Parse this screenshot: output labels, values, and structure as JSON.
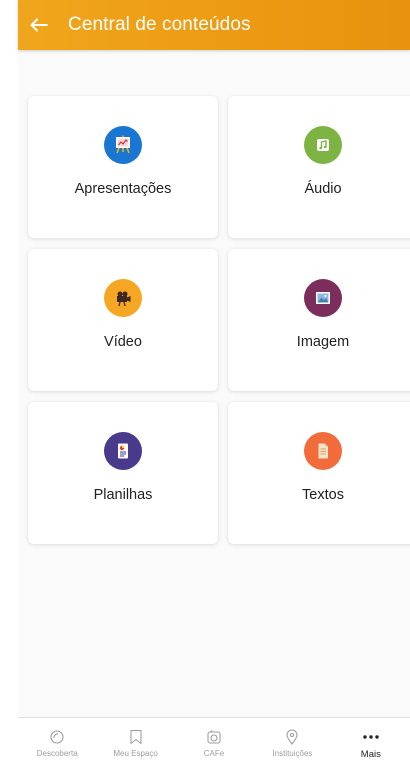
{
  "header": {
    "title": "Central de conteúdos",
    "back_icon": "arrow-left-icon",
    "background": "#ee9f16"
  },
  "content_types": [
    {
      "label": "Apresentações",
      "icon": "presentation-icon",
      "color": "#1976d2"
    },
    {
      "label": "Áudio",
      "icon": "music-note-icon",
      "color": "#7cb342"
    },
    {
      "label": "Vídeo",
      "icon": "video-camera-icon",
      "color": "#f5a623"
    },
    {
      "label": "Imagem",
      "icon": "image-icon",
      "color": "#7b2d5c"
    },
    {
      "label": "Planilhas",
      "icon": "spreadsheet-icon",
      "color": "#4a3a8c"
    },
    {
      "label": "Textos",
      "icon": "document-icon",
      "color": "#f26b3a"
    }
  ],
  "bottom_nav": [
    {
      "label": "Descoberta",
      "icon": "discover-icon",
      "active": false
    },
    {
      "label": "Meu Espaço",
      "icon": "bookmark-icon",
      "active": false
    },
    {
      "label": "CAFe",
      "icon": "cafe-icon",
      "active": false
    },
    {
      "label": "Instituições",
      "icon": "location-pin-icon",
      "active": false
    },
    {
      "label": "Mais",
      "icon": "more-dots-icon",
      "active": true
    }
  ]
}
